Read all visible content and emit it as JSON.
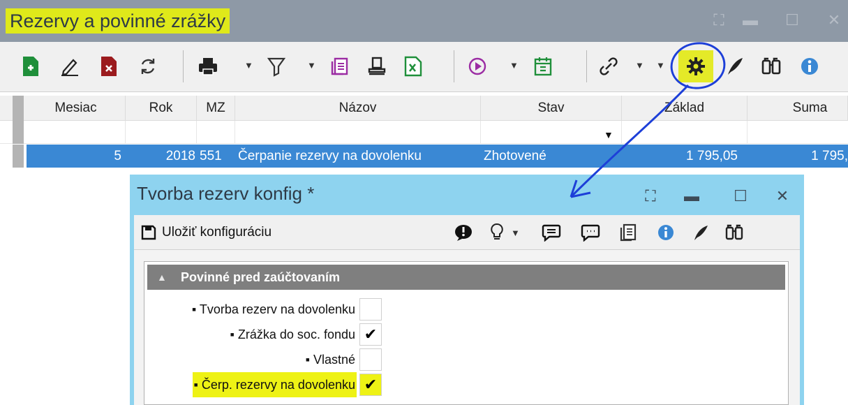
{
  "window": {
    "title": "Rezervy a povinné zrážky",
    "controls": {
      "maximize": "⛶",
      "minimize": "▬",
      "restore": "☐",
      "close": "✕"
    }
  },
  "toolbar": {
    "icons": [
      "new-doc-icon",
      "edit-icon",
      "delete-doc-icon",
      "refresh-icon",
      "print-icon",
      "filter-icon",
      "notes-icon",
      "stamp-icon",
      "excel-icon",
      "play-icon",
      "calendar-icon",
      "link-icon",
      "settings-icon",
      "quill-icon",
      "binoculars-icon",
      "info-icon"
    ]
  },
  "grid": {
    "columns": [
      "Mesiac",
      "Rok",
      "MZ",
      "Názov",
      "Stav",
      "Základ",
      "Suma"
    ],
    "rows": [
      {
        "mesiac": "5",
        "rok": "2018",
        "mz": "551",
        "nazov": "Čerpanie rezervy na dovolenku",
        "stav": "Zhotovené",
        "zaklad": "1 795,05",
        "suma": "1 795,"
      }
    ]
  },
  "dialog": {
    "title": "Tvorba rezerv konfig *",
    "save_label": "Uložiť konfiguráciu",
    "group": "Povinné pred zaúčtovaním",
    "items": [
      {
        "label": "▪ Tvorba rezerv na dovolenku",
        "checked": ""
      },
      {
        "label": "▪ Zrážka do soc. fondu",
        "checked": "✔"
      },
      {
        "label": "▪ Vlastné",
        "checked": ""
      },
      {
        "label": "▪ Čerp. rezervy na dovolenku",
        "checked": "✔"
      }
    ]
  },
  "colors": {
    "title_bar": "#8e99a6",
    "highlight": "#dfe91a",
    "selection": "#3a88d4",
    "dialog_bar": "#8ed3ef",
    "annotation": "#1d3fd8"
  }
}
